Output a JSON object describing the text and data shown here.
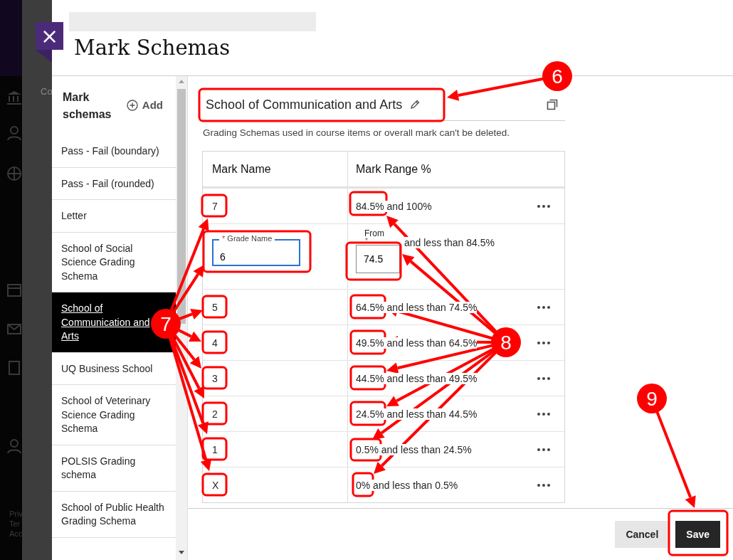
{
  "backdrop": {
    "texts": [
      "Co",
      "Priv",
      "Ter",
      "Acc"
    ]
  },
  "panel": {
    "title": "Mark Schemas",
    "close_label": "×"
  },
  "sidebar": {
    "heading": "Mark schemas",
    "add_label": "Add",
    "items": [
      {
        "label": "Pass - Fail (boundary)",
        "selected": false
      },
      {
        "label": "Pass - Fail (rounded)",
        "selected": false
      },
      {
        "label": "Letter",
        "selected": false
      },
      {
        "label": "School of Social Science Grading Schema",
        "selected": false
      },
      {
        "label": "School of Communication and Arts",
        "selected": true
      },
      {
        "label": "UQ Business School",
        "selected": false
      },
      {
        "label": "School of Veterinary Science Grading Schema",
        "selected": false
      },
      {
        "label": "POLSIS Grading schema",
        "selected": false
      },
      {
        "label": "School of Public Health Grading Schema",
        "selected": false
      }
    ]
  },
  "schema": {
    "title": "School of Communication and Arts",
    "note": "Grading Schemas used in course items or overall mark can't be deleted.",
    "columns": [
      "Mark Name",
      "Mark Range %"
    ],
    "rows": [
      {
        "kind": "view",
        "name": "7",
        "range": "84.5% and 100%"
      },
      {
        "kind": "edit",
        "name_label": "Grade Name",
        "required_mark": "*",
        "name": "6",
        "from_label": "From",
        "from_required": "*",
        "from_value": "74.5",
        "range": "and less than 84.5%"
      },
      {
        "kind": "view",
        "name": "5",
        "range": "64.5% and less than 74.5%"
      },
      {
        "kind": "view",
        "name": "4",
        "range": "49.5% and less than 64.5%"
      },
      {
        "kind": "view",
        "name": "3",
        "range": "44.5% and less than 49.5%"
      },
      {
        "kind": "view",
        "name": "2",
        "range": "24.5% and less than 44.5%"
      },
      {
        "kind": "view",
        "name": "1",
        "range": "0.5% and less than 24.5%"
      },
      {
        "kind": "view",
        "name": "X",
        "range": "0% and less than 0.5%"
      }
    ]
  },
  "footer": {
    "buttons": [
      {
        "label": "Cancel",
        "kind": "secondary"
      },
      {
        "label": "Save",
        "kind": "primary"
      }
    ]
  },
  "callouts": [
    {
      "label": "6"
    },
    {
      "label": "7"
    },
    {
      "label": "8"
    },
    {
      "label": "9"
    }
  ]
}
